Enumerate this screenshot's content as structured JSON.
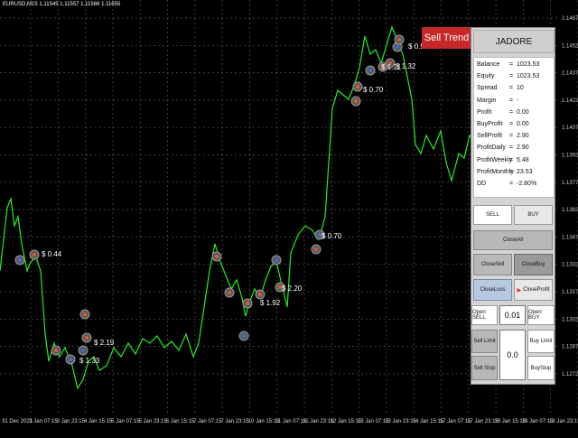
{
  "chart": {
    "symbol_line": "EURUSD,M15  1.11545 1.11557 1.11566 1.11655",
    "price_labels": [
      "1.14670",
      "1.14520",
      "1.14370",
      "1.14220",
      "1.14070",
      "1.13920",
      "1.13770",
      "1.13620",
      "1.13470",
      "1.13320",
      "1.13170",
      "1.13020",
      "1.12870",
      "1.12720"
    ],
    "time_labels": [
      "31 Dec 2021",
      "3 Jan 07:15",
      "3 Jan 23:15",
      "4 Jan 15:15",
      "5 Jan 07:15",
      "5 Jan 23:15",
      "6 Jan 15:15",
      "7 Jan 07:15",
      "7 Jan 23:15",
      "10 Jan 15:15",
      "11 Jan 07:15",
      "11 Jan 23:15",
      "12 Jan 15:15",
      "13 Jan 07:15",
      "13 Jan 23:15",
      "14 Jan 15:15",
      "17 Jan 07:15",
      "17 Jan 23:15",
      "18 Jan 15:15",
      "19 Jan 07:15",
      "19 Jan 23:15"
    ],
    "profit_labels": [
      "$ 0.44",
      "$ 2.19",
      "$ 1.33",
      "$ 2.20",
      "$ 1.92",
      "$ 0.70",
      "$ 0.70",
      "$ 1.21",
      "$ 1.32",
      "$ 0.50"
    ],
    "colors": {
      "price_line": "#22ee22",
      "grid": "#555555",
      "background": "#000000"
    }
  },
  "sell_trend": "Sell Trend",
  "panel": {
    "title": "JADORE",
    "stats": [
      {
        "key": "Balance",
        "val": "1023.53"
      },
      {
        "key": "Equity",
        "val": "1023.53"
      },
      {
        "key": "Spread",
        "val": "10"
      },
      {
        "key": "Margin",
        "val": "-"
      },
      {
        "key": "Profit",
        "val": "0.00"
      },
      {
        "key": "BuyProfit",
        "val": "0.00"
      },
      {
        "key": "SellProfit",
        "val": "2.90"
      },
      {
        "key": "ProfitDaily",
        "val": "2.90"
      },
      {
        "key": "ProfitWeekly",
        "val": "5.48"
      },
      {
        "key": "ProfitMonthly",
        "val": "23.53"
      },
      {
        "key": "DD",
        "val": "-2.80%"
      }
    ],
    "eq": "=",
    "sell_btn": "SELL",
    "buy_btn": "BUY",
    "close_all": "CloseAll",
    "close_sell": "CloseSell",
    "close_buy": "CloseBuy",
    "close_loss": "CloseLoss",
    "close_profit": "CloseProfit",
    "open_sell": "Open SELL",
    "open_buy": "Open BUY",
    "lot_value": "0.01",
    "sell_limit": "Sell Limit",
    "buy_limit": "Buy Limit",
    "pending_value": "0.0",
    "sell_stop": "Sell Stop",
    "buy_stop": "BuyStop"
  }
}
